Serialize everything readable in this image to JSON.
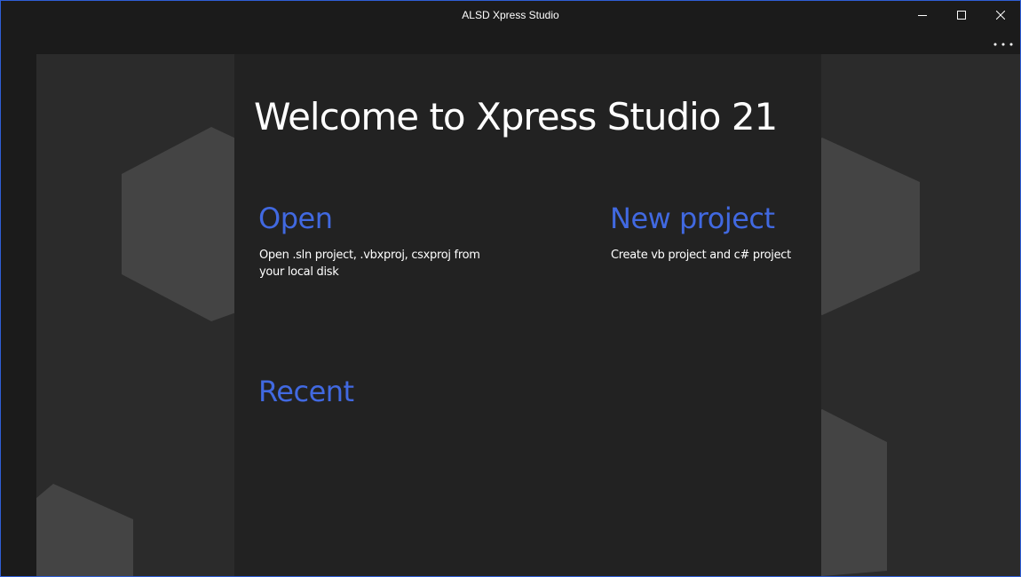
{
  "window": {
    "title": "ALSD Xpress Studio",
    "controls": {
      "minimize": "minimize-icon",
      "maximize": "maximize-icon",
      "close": "close-icon"
    },
    "more_menu": "more-options-icon"
  },
  "start_page": {
    "heading": "Welcome to Xpress Studio 21",
    "open": {
      "label": "Open",
      "description": "Open .sln project, .vbxproj, csxproj from your local disk"
    },
    "new_project": {
      "label": "New project",
      "description": "Create vb project and c# project"
    },
    "recent": {
      "label": "Recent",
      "items": []
    }
  },
  "colors": {
    "accent": "#4169e1",
    "window_border": "#2f5fd6",
    "background": "#1b1b1b",
    "panel": "#222222",
    "canvas": "#2b2b2b",
    "shapes": "#444444"
  }
}
